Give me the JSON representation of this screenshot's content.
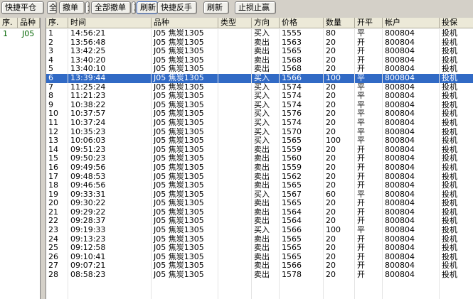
{
  "toolbar": {
    "buttons": [
      "快捷平仓",
      "全",
      "撤单",
      "全",
      "全部撤单",
      "三",
      "刷新",
      "快捷反手",
      "刷新",
      "止损止赢"
    ]
  },
  "left_panel": {
    "headers": [
      "序.",
      "品种"
    ],
    "rows": [
      [
        "1",
        "J05"
      ]
    ]
  },
  "orders": {
    "headers": [
      "序.",
      "时间",
      "品种",
      "类型",
      "方向",
      "价格",
      "数量",
      "开平",
      "帐户",
      "投保"
    ],
    "selected_index": 5,
    "rows": [
      [
        "1",
        "14:56:21",
        "J05 焦炭1305",
        "",
        "买入",
        "1555",
        "80",
        "平",
        "800804",
        "投机"
      ],
      [
        "2",
        "13:56:48",
        "J05 焦炭1305",
        "",
        "卖出",
        "1563",
        "20",
        "开",
        "800804",
        "投机"
      ],
      [
        "3",
        "13:42:25",
        "J05 焦炭1305",
        "",
        "卖出",
        "1565",
        "20",
        "开",
        "800804",
        "投机"
      ],
      [
        "4",
        "13:40:20",
        "J05 焦炭1305",
        "",
        "卖出",
        "1568",
        "20",
        "开",
        "800804",
        "投机"
      ],
      [
        "5",
        "13:40:10",
        "J05 焦炭1305",
        "",
        "卖出",
        "1568",
        "20",
        "开",
        "800804",
        "投机"
      ],
      [
        "6",
        "13:39:44",
        "J05 焦炭1305",
        "",
        "买入",
        "1566",
        "100",
        "平",
        "800804",
        "投机"
      ],
      [
        "7",
        "11:25:24",
        "J05 焦炭1305",
        "",
        "买入",
        "1574",
        "20",
        "平",
        "800804",
        "投机"
      ],
      [
        "8",
        "11:21:23",
        "J05 焦炭1305",
        "",
        "买入",
        "1574",
        "20",
        "平",
        "800804",
        "投机"
      ],
      [
        "9",
        "10:38:22",
        "J05 焦炭1305",
        "",
        "买入",
        "1574",
        "20",
        "平",
        "800804",
        "投机"
      ],
      [
        "10",
        "10:37:57",
        "J05 焦炭1305",
        "",
        "买入",
        "1576",
        "20",
        "平",
        "800804",
        "投机"
      ],
      [
        "11",
        "10:37:24",
        "J05 焦炭1305",
        "",
        "买入",
        "1574",
        "20",
        "平",
        "800804",
        "投机"
      ],
      [
        "12",
        "10:35:23",
        "J05 焦炭1305",
        "",
        "买入",
        "1570",
        "20",
        "平",
        "800804",
        "投机"
      ],
      [
        "13",
        "10:06:03",
        "J05 焦炭1305",
        "",
        "买入",
        "1565",
        "100",
        "平",
        "800804",
        "投机"
      ],
      [
        "14",
        "09:51:23",
        "J05 焦炭1305",
        "",
        "卖出",
        "1559",
        "20",
        "开",
        "800804",
        "投机"
      ],
      [
        "15",
        "09:50:23",
        "J05 焦炭1305",
        "",
        "卖出",
        "1560",
        "20",
        "开",
        "800804",
        "投机"
      ],
      [
        "16",
        "09:49:56",
        "J05 焦炭1305",
        "",
        "卖出",
        "1559",
        "20",
        "开",
        "800804",
        "投机"
      ],
      [
        "17",
        "09:48:53",
        "J05 焦炭1305",
        "",
        "卖出",
        "1562",
        "20",
        "开",
        "800804",
        "投机"
      ],
      [
        "18",
        "09:46:56",
        "J05 焦炭1305",
        "",
        "卖出",
        "1565",
        "20",
        "开",
        "800804",
        "投机"
      ],
      [
        "19",
        "09:33:31",
        "J05 焦炭1305",
        "",
        "买入",
        "1567",
        "60",
        "平",
        "800804",
        "投机"
      ],
      [
        "20",
        "09:30:22",
        "J05 焦炭1305",
        "",
        "卖出",
        "1565",
        "20",
        "开",
        "800804",
        "投机"
      ],
      [
        "21",
        "09:29:22",
        "J05 焦炭1305",
        "",
        "卖出",
        "1564",
        "20",
        "开",
        "800804",
        "投机"
      ],
      [
        "22",
        "09:28:37",
        "J05 焦炭1305",
        "",
        "卖出",
        "1564",
        "20",
        "开",
        "800804",
        "投机"
      ],
      [
        "23",
        "09:19:33",
        "J05 焦炭1305",
        "",
        "买入",
        "1566",
        "100",
        "平",
        "800804",
        "投机"
      ],
      [
        "24",
        "09:13:23",
        "J05 焦炭1305",
        "",
        "卖出",
        "1565",
        "20",
        "开",
        "800804",
        "投机"
      ],
      [
        "25",
        "09:12:58",
        "J05 焦炭1305",
        "",
        "卖出",
        "1565",
        "20",
        "开",
        "800804",
        "投机"
      ],
      [
        "26",
        "09:10:41",
        "J05 焦炭1305",
        "",
        "卖出",
        "1565",
        "20",
        "开",
        "800804",
        "投机"
      ],
      [
        "27",
        "09:07:21",
        "J05 焦炭1305",
        "",
        "卖出",
        "1566",
        "20",
        "开",
        "800804",
        "投机"
      ],
      [
        "28",
        "08:58:23",
        "J05 焦炭1305",
        "",
        "卖出",
        "1578",
        "20",
        "开",
        "800804",
        "投机"
      ]
    ]
  }
}
